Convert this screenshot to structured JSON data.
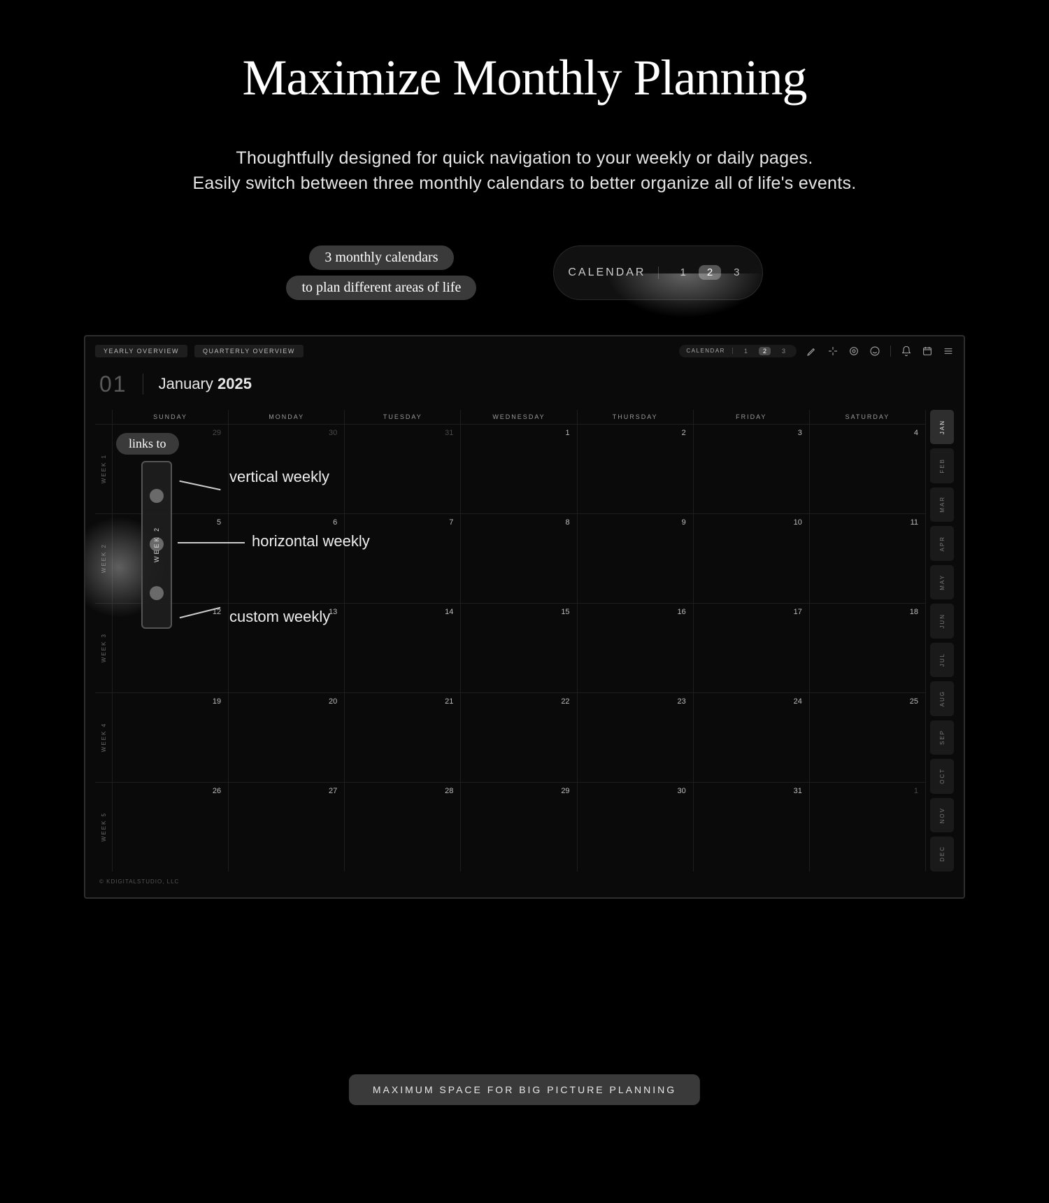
{
  "hero": {
    "title": "Maximize Monthly Planning",
    "sub1": "Thoughtfully designed for quick navigation to your weekly or daily pages.",
    "sub2": "Easily switch between three monthly calendars to better organize all of life's events."
  },
  "anno": {
    "three_cal_1": "3 monthly calendars",
    "three_cal_2": "to plan different areas of life",
    "links_to": "links to",
    "vertical": "vertical weekly",
    "horizontal": "horizontal weekly",
    "custom": "custom weekly"
  },
  "switch": {
    "label": "CALENDAR",
    "n1": "1",
    "n2": "2",
    "n3": "3",
    "active": "2"
  },
  "toolbar": {
    "yearly": "YEARLY OVERVIEW",
    "quarterly": "QUARTERLY OVERVIEW",
    "cal_label": "CALENDAR",
    "n1": "1",
    "n2": "2",
    "n3": "3"
  },
  "header": {
    "num": "01",
    "month": "January",
    "year": "2025"
  },
  "dow": [
    "SUNDAY",
    "MONDAY",
    "TUESDAY",
    "WEDNESDAY",
    "THURSDAY",
    "FRIDAY",
    "SATURDAY"
  ],
  "weeks": [
    "WEEK 1",
    "WEEK 2",
    "WEEK 3",
    "WEEK 4",
    "WEEK 5"
  ],
  "week_popup_label": "WEEK 2",
  "days": [
    {
      "n": "29",
      "other": true
    },
    {
      "n": "30",
      "other": true
    },
    {
      "n": "31",
      "other": true
    },
    {
      "n": "1"
    },
    {
      "n": "2"
    },
    {
      "n": "3"
    },
    {
      "n": "4"
    },
    {
      "n": "5"
    },
    {
      "n": "6"
    },
    {
      "n": "7"
    },
    {
      "n": "8"
    },
    {
      "n": "9"
    },
    {
      "n": "10"
    },
    {
      "n": "11"
    },
    {
      "n": "12"
    },
    {
      "n": "13"
    },
    {
      "n": "14"
    },
    {
      "n": "15"
    },
    {
      "n": "16"
    },
    {
      "n": "17"
    },
    {
      "n": "18"
    },
    {
      "n": "19"
    },
    {
      "n": "20"
    },
    {
      "n": "21"
    },
    {
      "n": "22"
    },
    {
      "n": "23"
    },
    {
      "n": "24"
    },
    {
      "n": "25"
    },
    {
      "n": "26"
    },
    {
      "n": "27"
    },
    {
      "n": "28"
    },
    {
      "n": "29"
    },
    {
      "n": "30"
    },
    {
      "n": "31"
    },
    {
      "n": "1",
      "other": true
    }
  ],
  "months": [
    "JAN",
    "FEB",
    "MAR",
    "APR",
    "MAY",
    "JUN",
    "JUL",
    "AUG",
    "SEP",
    "OCT",
    "NOV",
    "DEC"
  ],
  "active_month": "JAN",
  "credit": "© KDIGITALSTUDIO, LLC",
  "bottom_pill": "MAXIMUM SPACE FOR BIG PICTURE PLANNING"
}
